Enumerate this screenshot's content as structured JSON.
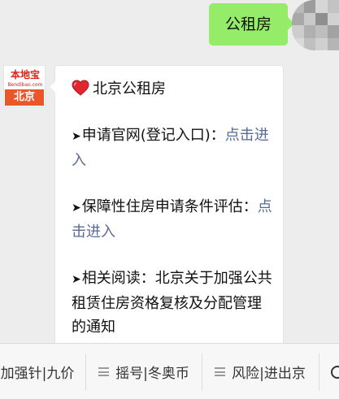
{
  "chat": {
    "user_message": "公租房",
    "bot_avatar": {
      "brand": "本地宝",
      "domain": "Bendibao.com",
      "city": "北京"
    },
    "bot_message": {
      "title_icon": "red-heart-icon",
      "title": "北京公租房",
      "item1_label": "申请官网(登记入口)：",
      "item1_link": "点击进入",
      "item2_label": "保障性住房申请条件评估：",
      "item2_link": "点击进入",
      "item3_label": "相关阅读：北京关于加强公共租赁住房资格复核及分配管理的通知"
    }
  },
  "menu": {
    "items": [
      "加强针|九价",
      "摇号|冬奥币",
      "风险|进出京"
    ],
    "last_icon": "keyboard-toggle-icon"
  },
  "colors": {
    "user_bubble": "#95ec69",
    "link": "#576b95",
    "background": "#ededed",
    "brand_red": "#d8231b"
  }
}
